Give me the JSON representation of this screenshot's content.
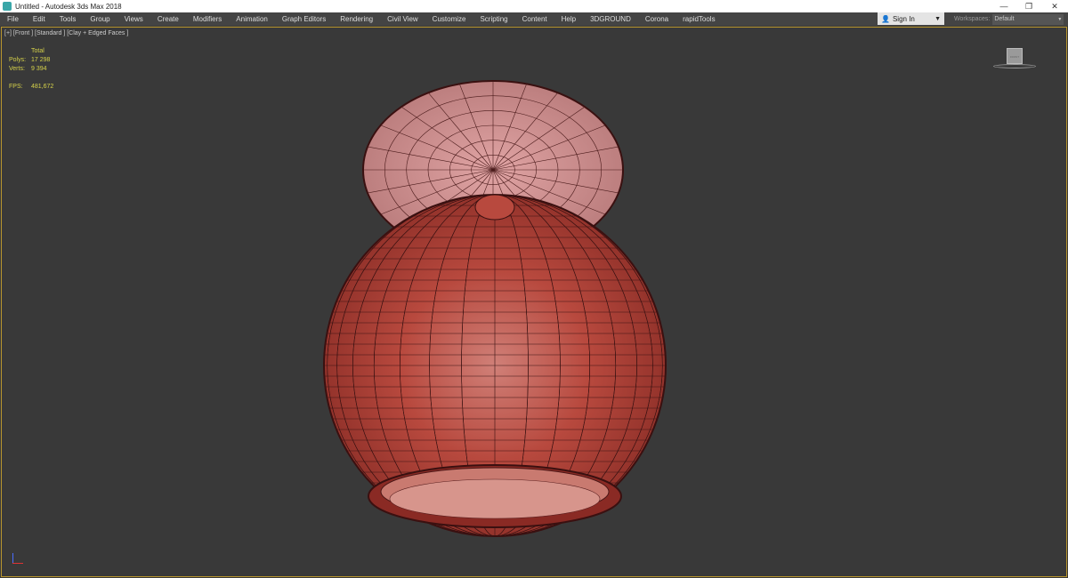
{
  "window": {
    "title": "Untitled - Autodesk 3ds Max 2018",
    "minimize": "—",
    "restore": "❐",
    "close": "✕"
  },
  "menu": [
    "File",
    "Edit",
    "Tools",
    "Group",
    "Views",
    "Create",
    "Modifiers",
    "Animation",
    "Graph Editors",
    "Rendering",
    "Civil View",
    "Customize",
    "Scripting",
    "Content",
    "Help",
    "3DGROUND",
    "Corona",
    "rapidTools"
  ],
  "signin": {
    "label": "Sign In",
    "icon": "user-icon"
  },
  "workspaces": {
    "label": "Workspaces:",
    "value": "Default"
  },
  "viewport": {
    "label": "[+] [Front ] [Standard ] [Clay + Edged Faces ]",
    "stats": {
      "header": "Total",
      "polys_label": "Polys:",
      "polys": "17 298",
      "verts_label": "Verts:",
      "verts": "9 394",
      "fps_label": "FPS:",
      "fps": "481,672"
    },
    "viewcube_face": "FRONT",
    "active_border_color": "#b8952e",
    "model_color": "#b8443a"
  }
}
